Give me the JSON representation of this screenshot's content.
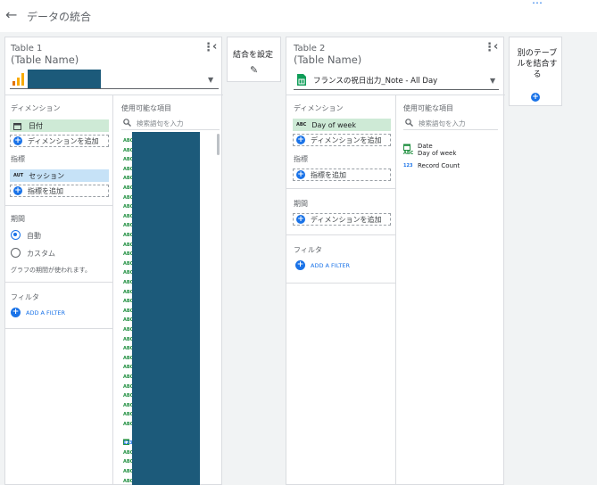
{
  "header": {
    "back_icon": "←",
    "title": "データの統合",
    "more_icon": "⋯"
  },
  "table1": {
    "name": "Table 1",
    "subname": "(Table Name)",
    "more_icon": "⋮",
    "collapse_icon": "‹",
    "source_icon": "analytics-bar-icon",
    "dropdown_arrow": "▼",
    "dimensions_label": "ディメンション",
    "dimension_chip": "日付",
    "dimension_type": "calendar-icon",
    "add_dimension": "ディメンションを追加",
    "metrics_label": "指標",
    "metric_tag": "AUT",
    "metric_chip": "セッション",
    "add_metric": "指標を追加",
    "period_label": "期間",
    "period_auto": "自動",
    "period_custom": "カスタム",
    "period_note": "グラフの期間が使われます。",
    "filter_label": "フィルタ",
    "add_filter": "ADD A FILTER",
    "available_fields_label": "使用可能な項目",
    "search_placeholder": "検索語句を入力",
    "field_types": [
      "ABC",
      "ABC",
      "ABC",
      "ABC",
      "ABC",
      "ABC",
      "ABC",
      "ABC",
      "ABC",
      "ABC",
      "ABC",
      "ABC",
      "ABC",
      "ABC",
      "ABC",
      "ABC",
      "ABC",
      "ABC",
      "ABC",
      "ABC",
      "ABC",
      "ABC",
      "ABC",
      "ABC",
      "ABC",
      "ABC",
      "ABC",
      "ABC",
      "ABC",
      "ABC",
      "ABC",
      "CAL",
      "123",
      "ABC",
      "ABC",
      "ABC",
      "ABC"
    ]
  },
  "join": {
    "label": "結合を設定",
    "edit_icon": "✎"
  },
  "table2": {
    "name": "Table 2",
    "subname": "(Table Name)",
    "more_icon": "⋮",
    "collapse_icon": "‹",
    "source_icon": "sheets-icon",
    "source_name": "フランスの祝日出力_Note - All Day",
    "dropdown_arrow": "▼",
    "dimensions_label": "ディメンション",
    "dimension_tag": "ABC",
    "dimension_chip": "Day of week",
    "add_dimension": "ディメンションを追加",
    "metrics_label": "指標",
    "add_metric": "指標を追加",
    "period_label": "期間",
    "add_period_dimension": "ディメンションを追加",
    "filter_label": "フィルタ",
    "add_filter": "ADD A FILTER",
    "available_fields_label": "使用可能な項目",
    "search_placeholder": "検索語句を入力",
    "fields": [
      {
        "type": "CAL",
        "name": "Date"
      },
      {
        "type": "ABC",
        "name": "Day of week"
      },
      {
        "type": "123",
        "name": "Record Count"
      }
    ]
  },
  "add_table": {
    "label": "別のテーブルを結合する",
    "plus": "+"
  },
  "colors": {
    "accent": "#1a73e8",
    "chip_green": "#ceead6",
    "chip_blue": "#c6e2f7",
    "redaction": "#1c5a7a"
  }
}
